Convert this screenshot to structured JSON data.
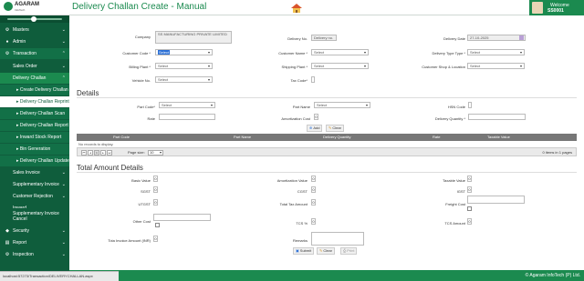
{
  "app": {
    "name": "AGARAM",
    "tagline": "InfoTech"
  },
  "page_title": "Delivery Challan Create - Manual",
  "user": {
    "welcome": "Welcome",
    "name": "SS0001"
  },
  "sidebar": {
    "items": [
      {
        "label": "Masters",
        "icon": "gear-icon"
      },
      {
        "label": "Admin",
        "icon": "user-icon"
      },
      {
        "label": "Transaction",
        "icon": "gear-icon"
      },
      {
        "label": "Sales Order"
      },
      {
        "label": "Delivery Challan"
      },
      {
        "label": "Create Delivery Challan"
      },
      {
        "label": "Delivery Challan Reprint"
      },
      {
        "label": "Delivery Challan Scan"
      },
      {
        "label": "Delivery Challan Report"
      },
      {
        "label": "Inward Stock Report"
      },
      {
        "label": "Bin Generation"
      },
      {
        "label": "Delivery Challan Update"
      },
      {
        "label": "Sales Invoice"
      },
      {
        "label": "Supplementary Invoice"
      },
      {
        "label": "Customer Rejection"
      },
      {
        "label": "Inward"
      },
      {
        "label": "Supplementary Invoice Cancel"
      },
      {
        "label": "Security",
        "icon": "shield-icon"
      },
      {
        "label": "Report",
        "icon": "report-icon"
      },
      {
        "label": "Inspection",
        "icon": "gear-icon"
      }
    ]
  },
  "form": {
    "company_label": "Company",
    "company_value": "SS MANUFACTURING PRIVATE LIMITED",
    "delivery_no_label": "Delivery No.",
    "delivery_no_placeholder": "Delivery no.",
    "delivery_date_label": "Delivery Date",
    "delivery_date_value": "27-10-2025",
    "customer_code_label": "Customer Code *",
    "customer_code_value": "Select",
    "customer_name_label": "Customer Name *",
    "customer_name_value": "Select",
    "delivery_type_label": "Delivery Type Type *",
    "delivery_type_value": "Select",
    "billing_plant_label": "Billing Plant *",
    "billing_plant_value": "Select",
    "shipping_plant_label": "Shipping Plant *",
    "shipping_plant_value": "Select",
    "customer_shop_label": "Customer Shop & Location",
    "customer_shop_value": "Select",
    "vehicle_no_label": "Vehicle No.",
    "vehicle_no_value": "Select",
    "tax_code_label": "Tax Code*"
  },
  "details": {
    "title": "Details",
    "part_code_label": "Part Code*",
    "part_code_value": "Select",
    "part_name_label": "Part Name",
    "part_name_value": "Select",
    "hsn_code_label": "HSN Code",
    "rate_label": "Rate",
    "amortization_cost_label": "Amortization Cost",
    "amortization_cost_value": "0",
    "delivery_quantity_label": "Delivery Quantity *",
    "add_label": "Add",
    "clear_label": "Clear"
  },
  "grid": {
    "columns": [
      "Part Code",
      "Part Name",
      "Delivery Quantity",
      "Rate",
      "Taxable Value"
    ],
    "no_records": "No records to display.",
    "page_current": "1",
    "page_size_label": "Page size:",
    "page_size_value": "10",
    "items_info": "0 items in 1 pages"
  },
  "totals": {
    "title": "Total Amount Details",
    "basic_value_label": "Basic Value",
    "basic_value": "0",
    "amortization_value_label": "Amortization Value",
    "amortization_value": "0",
    "taxable_value_label": "Taxable Value",
    "taxable_value": "0",
    "sgst_label": "SGST",
    "sgst": "0",
    "cgst_label": "CGST",
    "cgst": "0",
    "igst_label": "IGST",
    "igst": "0",
    "utgst_label": "UTGST",
    "utgst": "0",
    "total_tax_label": "Total Tax Amount",
    "total_tax": "0",
    "freight_cost_label": "Freight Cost",
    "other_cost_label": "Other Cost",
    "tcs_pct_label": "TCS %",
    "tcs_pct": "0",
    "tcs_amount_label": "TCS Amount",
    "tcs_amount": "0",
    "total_invoice_label": "Tota Invoice Amount (INR)",
    "total_invoice": "0",
    "remarks_label": "Remarks",
    "submit_label": "Submit",
    "clear_label": "Clear",
    "print_label": "Print"
  },
  "status_url": "localhost:57273/Transaction/DELIVERYCHALLAN.aspx",
  "footer": "© Agaram InfoTech (P) Ltd.",
  "colors": {
    "brand": "#0f5d3c",
    "accent": "#1b8a4f"
  }
}
